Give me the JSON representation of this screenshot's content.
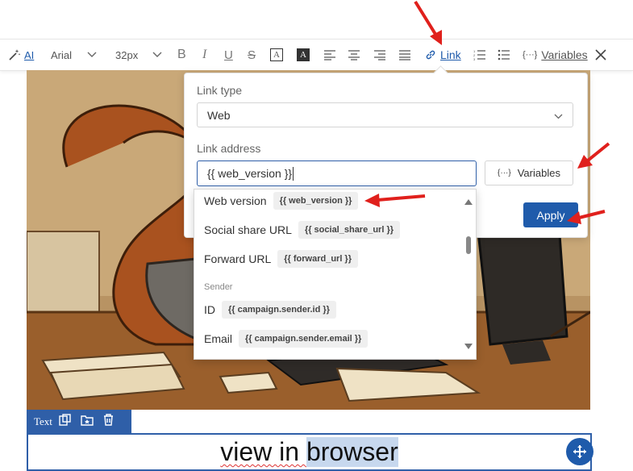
{
  "toolbar": {
    "ai_label": "AI",
    "font_family": "Arial",
    "font_size": "32px",
    "bold_label": "B",
    "italic_label": "I",
    "underline_label": "U",
    "strike_label": "S",
    "text_color_label": "A",
    "highlight_label": "A",
    "link_label": "Link",
    "variables_label": "Variables",
    "accent": "#1f5bab"
  },
  "link_popup": {
    "link_type_label": "Link type",
    "link_type_value": "Web",
    "link_address_label": "Link address",
    "link_address_value": "{{ web_version }}",
    "variables_button": "Variables",
    "apply_button": "Apply"
  },
  "variables_dropdown": {
    "items": [
      {
        "label": "Web version",
        "token": "{{ web_version }}"
      },
      {
        "label": "Social share URL",
        "token": "{{ social_share_url }}"
      },
      {
        "label": "Forward URL",
        "token": "{{ forward_url }}"
      }
    ],
    "section_sender": "Sender",
    "sender_items": [
      {
        "label": "ID",
        "token": "{{ campaign.sender.id }}"
      },
      {
        "label": "Email",
        "token": "{{ campaign.sender.email }}"
      }
    ]
  },
  "text_block": {
    "toolbar_label": "Text",
    "content_prefix": "view in ",
    "content_selected": "browser"
  },
  "annotation_color": "#e0201c"
}
